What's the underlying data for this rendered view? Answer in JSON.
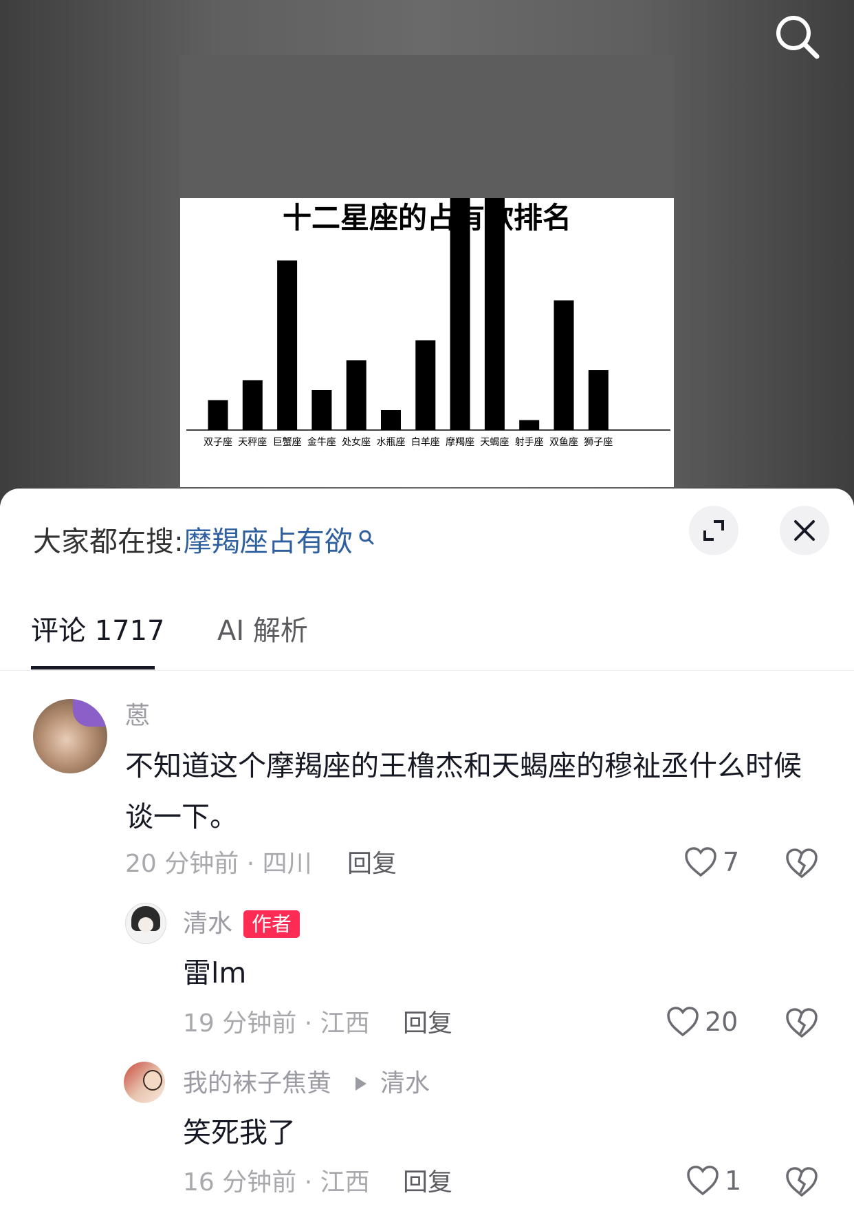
{
  "video": {
    "chart_data": {
      "type": "bar",
      "title": "十二星座的占有欲排名",
      "categories": [
        "双子座",
        "天秤座",
        "巨蟹座",
        "金牛座",
        "处女座",
        "水瓶座",
        "白羊座",
        "摩羯座",
        "天蝎座",
        "射手座",
        "双鱼座",
        "狮子座"
      ],
      "values": [
        15,
        25,
        85,
        20,
        35,
        10,
        45,
        999,
        999,
        5,
        65,
        30
      ],
      "grid": false,
      "legend": "none",
      "colors": {
        "bar": "#000000"
      }
    }
  },
  "icons": {
    "search": "search-icon",
    "expand": "expand-icon",
    "close": "close-icon",
    "like": "heart-icon",
    "dislike": "broken-heart-icon",
    "reply_arrow": "triangle-right-icon"
  },
  "suggest": {
    "label": "大家都在搜:",
    "keyword": "摩羯座占有欲"
  },
  "tabs": [
    {
      "label": "评论 1717"
    },
    {
      "label": "AI 解析"
    }
  ],
  "comments": [
    {
      "name": "蒽",
      "text": "不知道这个摩羯座的王橹杰和天蝎座的穆祉丞什么时候谈一下。",
      "meta": "20 分钟前 · 四川",
      "reply": "回复",
      "likes": "7"
    },
    {
      "name": "清水",
      "badge": "作者",
      "text": "雷lm",
      "meta": "19 分钟前 · 江西",
      "reply": "回复",
      "likes": "20"
    },
    {
      "name": "我的袜子焦黄",
      "reply_to": "清水",
      "text": "笑死我了",
      "meta": "16 分钟前 · 江西",
      "reply": "回复",
      "likes": "1"
    }
  ]
}
